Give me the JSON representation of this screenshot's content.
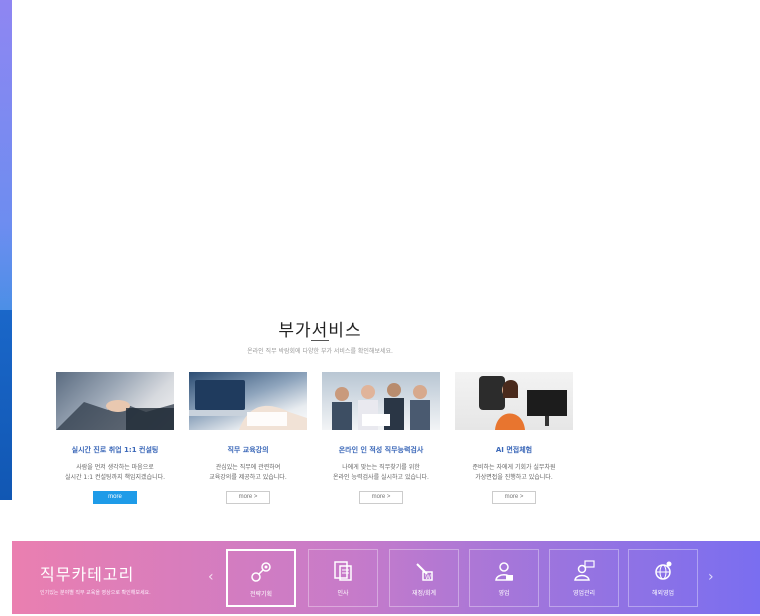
{
  "addon": {
    "title": "부가서비스",
    "subtitle": "온라인 직무 박람회에 다양한 부가 서비스를 확인해보세요."
  },
  "cards": [
    {
      "title": "실시간 진로 취업 1:1 컨설팅",
      "desc1": "사람을 먼저 생각하는 마음으로",
      "desc2": "실시간 1:1 컨설팅까지 책임지겠습니다.",
      "button": "more"
    },
    {
      "title": "직무 교육강의",
      "desc1": "관심있는 직무에 관련하여",
      "desc2": "교육강의를 제공하고 있습니다.",
      "button": "more >"
    },
    {
      "title": "온라인 인 적성 직무능력검사",
      "desc1": "나에게 맞는는 직무찾기를 위한",
      "desc2": "온라인 능력검사를 실시하고 있습니다.",
      "button": "more >"
    },
    {
      "title": "AI 면접체험",
      "desc1": "준비하는 자에게 기회가 실무차원",
      "desc2": "가상면접을 진행하고 있습니다.",
      "button": "more >"
    }
  ],
  "category": {
    "title": "직무카테고리",
    "subtitle": "인기있는 분야별 직무 교육을 영상으로 확인해보세요.",
    "prev": "‹",
    "next": "›",
    "items": [
      {
        "label": "전략기획",
        "icon": "strategy-icon"
      },
      {
        "label": "인사",
        "icon": "hr-document-icon"
      },
      {
        "label": "재정/회계",
        "icon": "finance-icon"
      },
      {
        "label": "영업",
        "icon": "sales-icon"
      },
      {
        "label": "영업관리",
        "icon": "sales-management-icon"
      },
      {
        "label": "해외영업",
        "icon": "global-sales-icon"
      }
    ]
  },
  "colors": {
    "accent_blue": "#1e9be8",
    "card_title": "#3a67b8",
    "bar_start": "#ea7fb0",
    "bar_end": "#7a6ef0"
  }
}
